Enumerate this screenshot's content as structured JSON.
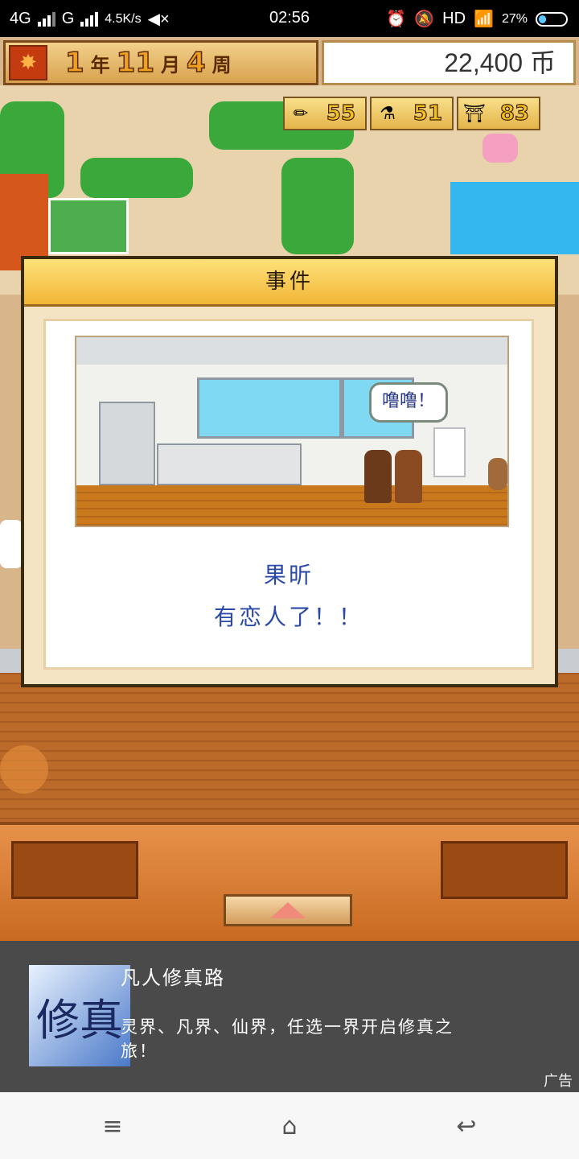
{
  "status_bar": {
    "network_1": "4G",
    "network_2": "G",
    "speed": "4.5K/s",
    "time": "02:56",
    "hd": "HD",
    "battery": "27%"
  },
  "hud": {
    "year_num": "1",
    "year_unit": "年",
    "month_num": "11",
    "month_unit": "月",
    "week_num": "4",
    "week_unit": "周",
    "money": "22,400 币",
    "stats": [
      {
        "icon": "pencil-icon",
        "value": "55"
      },
      {
        "icon": "flask-icon",
        "value": "51"
      },
      {
        "icon": "building-icon",
        "value": "83"
      }
    ]
  },
  "dialog": {
    "title": "事件",
    "bubble": "噜噜！",
    "message_line1": "果昕",
    "message_line2": "有恋人了！！"
  },
  "ad": {
    "logo_text": "修真",
    "title": "凡人修真路",
    "description": "灵界、凡界、仙界，任选一界开启修真之旅！",
    "tag": "广告"
  }
}
